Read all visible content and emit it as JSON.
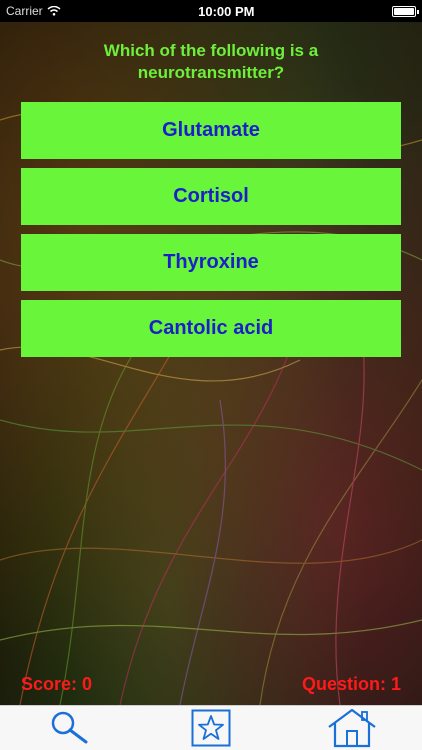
{
  "status_bar": {
    "carrier": "Carrier",
    "time": "10:00 PM",
    "icons": [
      "wifi-icon",
      "battery-icon"
    ]
  },
  "quiz": {
    "question": "Which of the following is a neurotransmitter?",
    "answers": [
      "Glutamate",
      "Cortisol",
      "Thyroxine",
      "Cantolic acid"
    ],
    "score_text": "Score: 0",
    "question_text": "Question: 1"
  },
  "tab_bar": {
    "tabs": [
      "search-icon",
      "star-icon",
      "home-icon"
    ]
  },
  "colors": {
    "question_text": "#6ef03a",
    "answer_bg": "#69f53a",
    "answer_text": "#1b1fc9",
    "score_text": "#ff1a1a",
    "tab_icon": "#1a6fd8"
  }
}
